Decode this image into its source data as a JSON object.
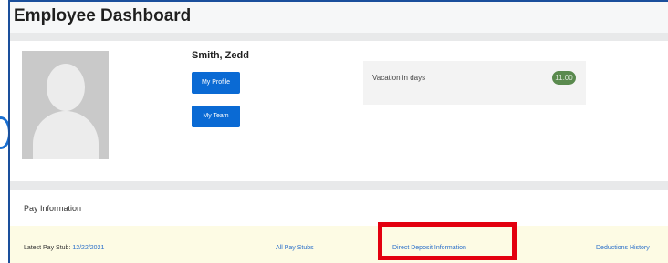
{
  "header": {
    "title": "Employee Dashboard"
  },
  "employee": {
    "name": "Smith, Zedd",
    "my_profile_label": "My Profile",
    "my_team_label": "My Team"
  },
  "vacation": {
    "label": "Vacation in days",
    "value": "11.00"
  },
  "pay_info": {
    "section_title": "Pay Information",
    "latest_label": "Latest Pay Stub:",
    "latest_date": "12/22/2021",
    "all_pay_stubs": "All Pay Stubs",
    "direct_deposit": "Direct Deposit Information",
    "deductions_history": "Deductions History"
  },
  "highlight_color": "#e3000f",
  "accent_color": "#0a6ad4"
}
